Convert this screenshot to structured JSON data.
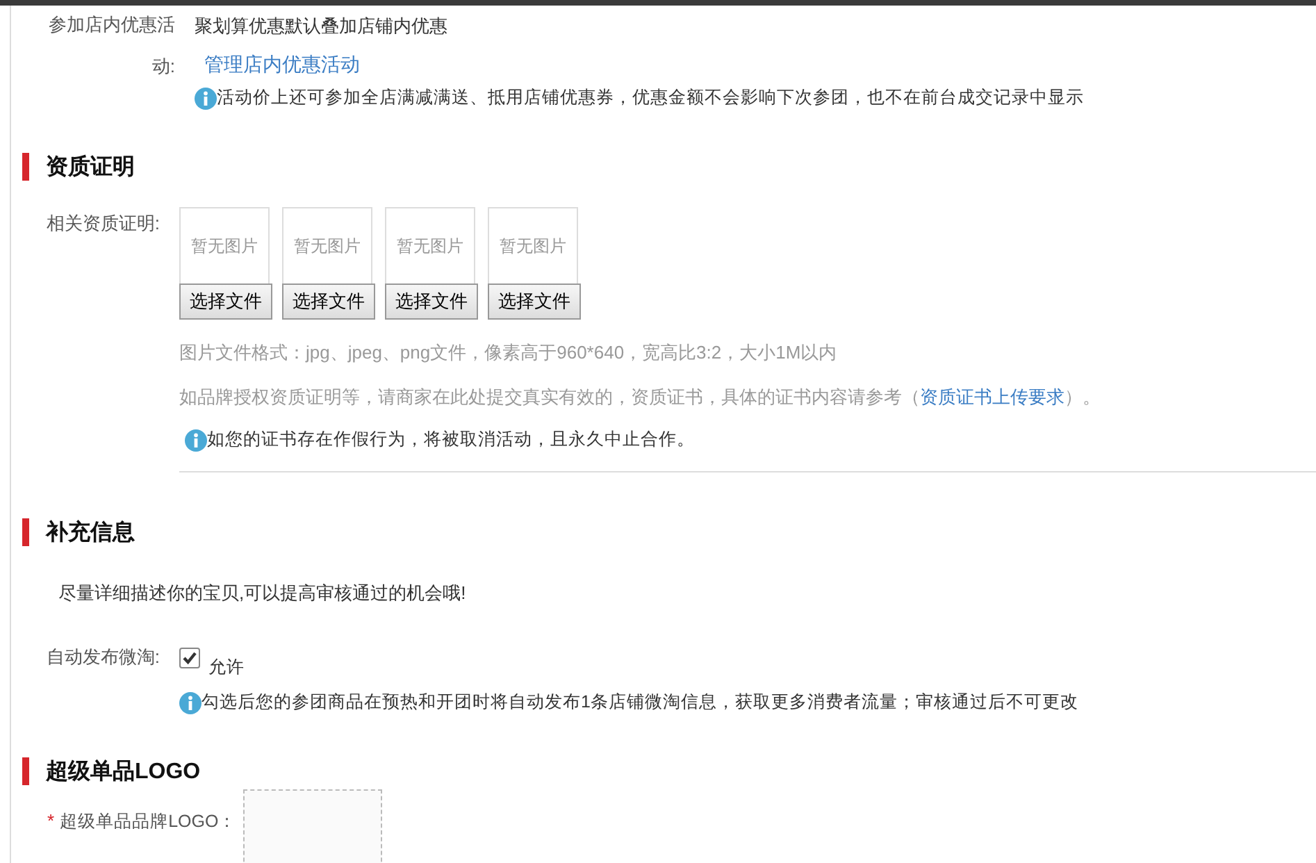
{
  "discount": {
    "label": "参加店内优惠活动:",
    "text": "聚划算优惠默认叠加店铺内优惠",
    "link": "管理店内优惠活动",
    "info": "活动价上还可参加全店满减满送、抵用店铺优惠券，优惠金额不会影响下次参团，也不在前台成交记录中显示"
  },
  "qualification": {
    "title": "资质证明",
    "label": "相关资质证明:",
    "images": [
      {
        "placeholder": "暂无图片",
        "button": "选择文件"
      },
      {
        "placeholder": "暂无图片",
        "button": "选择文件"
      },
      {
        "placeholder": "暂无图片",
        "button": "选择文件"
      },
      {
        "placeholder": "暂无图片",
        "button": "选择文件"
      }
    ],
    "format_hint": "图片文件格式：jpg、jpeg、png文件，像素高于960*640，宽高比3:2，大小1M以内",
    "note": {
      "before": "如品牌授权资质证明等，请商家在此处提交真实有效的，资质证书，具体的证书内容请参考（",
      "link": "资质证书上传要求",
      "after": "）。"
    },
    "info": "如您的证书存在作假行为，将被取消活动，且永久中止合作。"
  },
  "supplement": {
    "title": "补充信息",
    "description": "尽量详细描述你的宝贝,可以提高审核通过的机会哦!",
    "auto_post": {
      "label": "自动发布微淘:",
      "checked": true,
      "option": "允许"
    },
    "info": "勾选后您的参团商品在预热和开团时将自动发布1条店铺微淘信息，获取更多消费者流量；审核通过后不可更改"
  },
  "logo": {
    "title": "超级单品LOGO",
    "required_mark": "*",
    "label": "超级单品品牌LOGO："
  }
}
